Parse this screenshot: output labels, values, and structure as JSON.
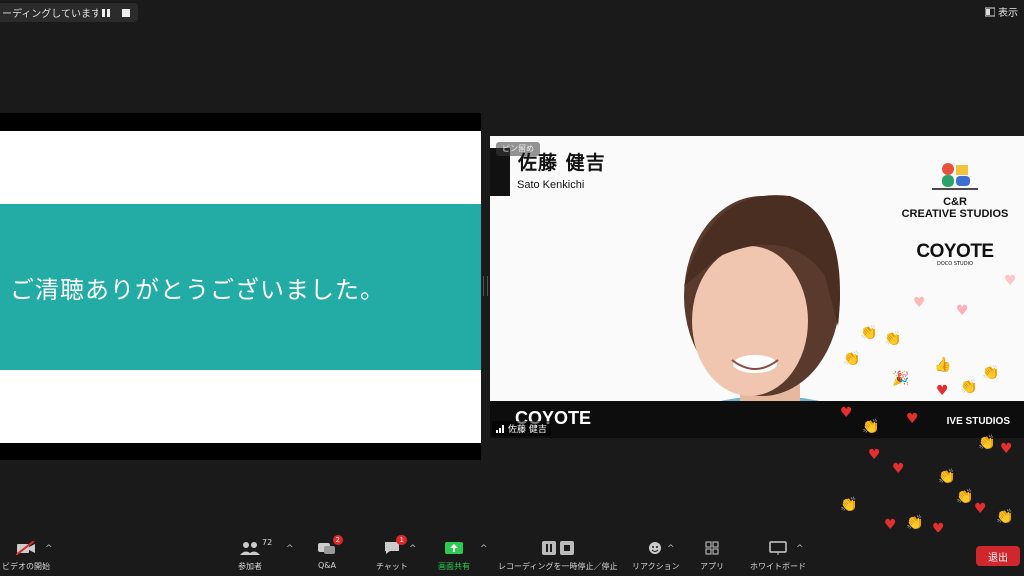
{
  "recording": {
    "status_text": "ーディングしています..."
  },
  "view_button": {
    "label": "表示"
  },
  "slide": {
    "text": "ご清聴ありがとうございました。"
  },
  "video": {
    "pin_label": "ピン留め",
    "name_jp": "佐藤 健吉",
    "name_en": "Sato Kenkichi",
    "logo_cr_line1": "C&R",
    "logo_cr_line2": "CREATIVE STUDIOS",
    "logo_coyote": "COYOTE",
    "logo_coyote_sub": "DOCO STUDIO",
    "bottom_coyote": "COYOTE",
    "bottom_studios": "IVE STUDIOS",
    "participant_name": "佐藤 健吉"
  },
  "toolbar": {
    "video": {
      "label": "ビデオの開始",
      "icon": "video-off-icon"
    },
    "participants": {
      "label": "参加者",
      "count": "72",
      "icon": "participants-icon"
    },
    "qa": {
      "label": "Q&A",
      "badge": "2",
      "icon": "qa-icon"
    },
    "chat": {
      "label": "チャット",
      "badge": "1",
      "icon": "chat-icon"
    },
    "share": {
      "label": "画面共有",
      "icon": "share-screen-icon",
      "color": "#2dcc4f"
    },
    "recording": {
      "label": "レコーディングを一時停止／停止",
      "icon": "recording-controls-icon"
    },
    "reactions": {
      "label": "リアクション",
      "icon": "reaction-icon"
    },
    "apps": {
      "label": "アプリ",
      "icon": "apps-icon"
    },
    "whiteboard": {
      "label": "ホワイトボード",
      "icon": "whiteboard-icon"
    },
    "leave": {
      "label": "退出",
      "color": "#d0272c"
    }
  },
  "colors": {
    "slide_band": "#23aba5",
    "background": "#1a1a1a"
  }
}
